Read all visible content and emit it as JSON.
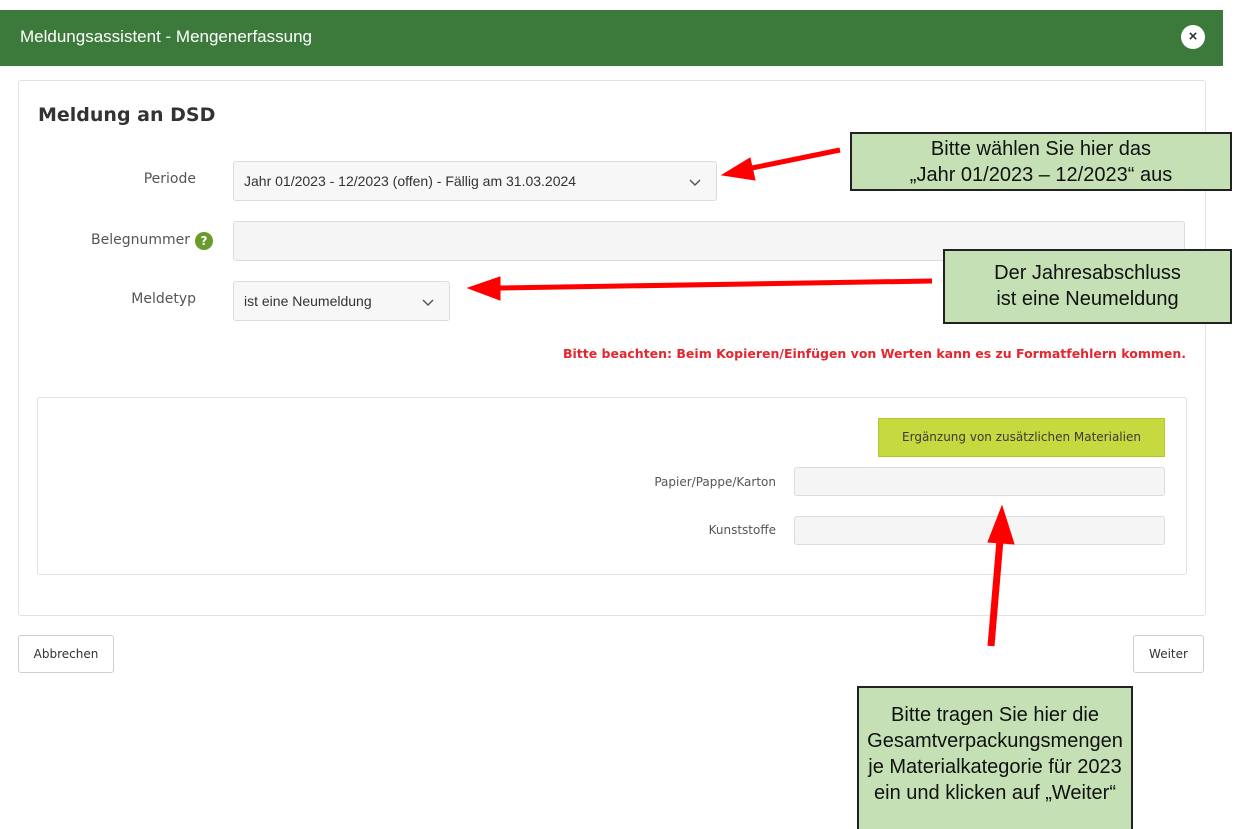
{
  "window": {
    "title": "Meldungsassistent - Mengenerfassung",
    "close_symbol": "×"
  },
  "form": {
    "heading": "Meldung an DSD",
    "periode": {
      "label": "Periode",
      "value": "Jahr 01/2023 - 12/2023 (offen) - Fällig am 31.03.2024"
    },
    "belegnummer": {
      "label": "Belegnummer",
      "help_symbol": "?",
      "value": ""
    },
    "meldetyp": {
      "label": "Meldetyp",
      "value": "ist eine Neumeldung"
    },
    "warning": "Bitte beachten: Beim Kopieren/Einfügen von Werten kann es zu Formatfehlern kommen."
  },
  "materials": {
    "add_button": "Ergänzung von zusätzlichen Materialien",
    "items": [
      {
        "label": "Papier/Pappe/Karton",
        "value": ""
      },
      {
        "label": "Kunststoffe",
        "value": ""
      }
    ]
  },
  "footer": {
    "cancel": "Abbrechen",
    "next": "Weiter"
  },
  "callouts": {
    "periode": [
      "Bitte wählen Sie hier das",
      "„Jahr 01/2023 – 12/2023“ aus"
    ],
    "meldetyp": [
      "Der Jahresabschluss",
      "ist eine Neumeldung"
    ],
    "mengen": [
      "Bitte tragen Sie hier die",
      "Gesamtverpackungsmengen",
      "je Materialkategorie für 2023",
      "ein und klicken auf „Weiter“"
    ]
  },
  "colors": {
    "header": "#3c7a3c",
    "accent_button": "#c6d93e",
    "warning": "#e5262f",
    "callout_bg": "#c5e0b4",
    "arrow": "#ff0000"
  }
}
